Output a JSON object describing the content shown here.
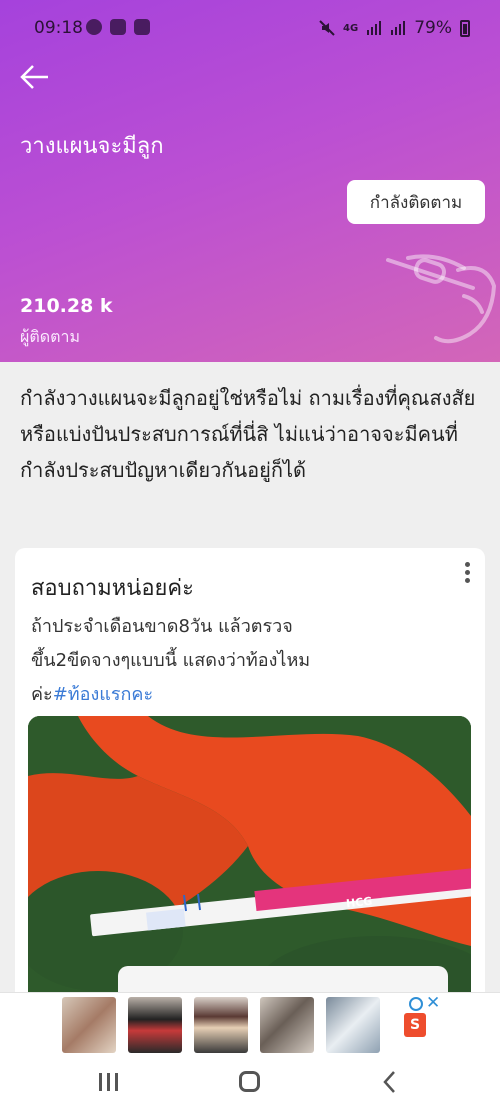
{
  "status_bar": {
    "time": "09:18",
    "network": "4G",
    "battery": "79%"
  },
  "header": {
    "title": "วางแผนจะมีลูก",
    "follow_button": "กำลังติดตาม",
    "followers_count": "210.28 k",
    "followers_label": "ผู้ติดตาม",
    "colors": {
      "gradient_start": "#a542dc",
      "gradient_end": "#d366b8"
    }
  },
  "description": "กำลังวางแผนจะมีลูกอยู่ใช่หรือไม่ ถามเรื่องที่คุณสงสัย หรือแบ่งปันประสบการณ์ที่นี่สิ ไม่แน่ว่าอาจจะมีคนที่กำลังประสบปัญหาเดียวกันอยู่ก็ได้",
  "post": {
    "title": "สอบถามหน่อยค่ะ",
    "body_line1": "ถ้าประจำเดือนขาด8วัน แล้วตรวจ",
    "body_line2": "ขึ้น2ขีดจางๆแบบนี้ แสดงว่าท้องไหม",
    "body_line3_prefix": "ค่ะ",
    "hashtag": "#ท้องแรกคะ",
    "image_text": "HCG"
  },
  "ad": {
    "close_symbol": "✕",
    "brand_icon": "S"
  }
}
